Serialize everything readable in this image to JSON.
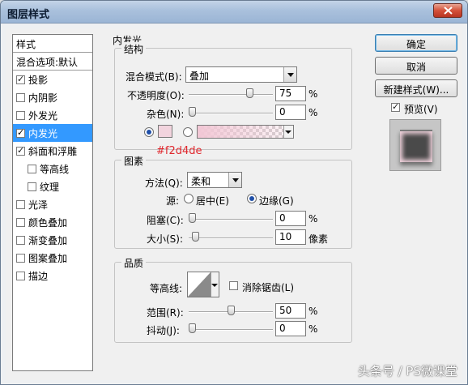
{
  "window": {
    "title": "图层样式"
  },
  "styles_list": {
    "header": "样式",
    "blend_options": "混合选项:默认",
    "items": [
      {
        "label": "投影",
        "checked": true,
        "indent": false,
        "selected": false
      },
      {
        "label": "内阴影",
        "checked": false,
        "indent": false,
        "selected": false
      },
      {
        "label": "外发光",
        "checked": false,
        "indent": false,
        "selected": false
      },
      {
        "label": "内发光",
        "checked": true,
        "indent": false,
        "selected": true
      },
      {
        "label": "斜面和浮雕",
        "checked": true,
        "indent": false,
        "selected": false
      },
      {
        "label": "等高线",
        "checked": false,
        "indent": true,
        "selected": false
      },
      {
        "label": "纹理",
        "checked": false,
        "indent": true,
        "selected": false
      },
      {
        "label": "光泽",
        "checked": false,
        "indent": false,
        "selected": false
      },
      {
        "label": "颜色叠加",
        "checked": false,
        "indent": false,
        "selected": false
      },
      {
        "label": "渐变叠加",
        "checked": false,
        "indent": false,
        "selected": false
      },
      {
        "label": "图案叠加",
        "checked": false,
        "indent": false,
        "selected": false
      },
      {
        "label": "描边",
        "checked": false,
        "indent": false,
        "selected": false
      }
    ]
  },
  "panel": {
    "title": "内发光",
    "structure": {
      "legend": "结构",
      "blend_mode_label": "混合模式(B):",
      "blend_mode_value": "叠加",
      "opacity_label": "不透明度(O):",
      "opacity_value": "75",
      "opacity_percent": 0.75,
      "noise_label": "杂色(N):",
      "noise_value": "0",
      "noise_percent": 0,
      "percent_unit": "%",
      "color_swatch": "#f2d4de",
      "color_hex_note": "#f2d4de",
      "color_mode": "solid"
    },
    "elements": {
      "legend": "图素",
      "method_label": "方法(Q):",
      "method_value": "柔和",
      "source_label": "源:",
      "source_center": "居中(E)",
      "source_edge": "边缘(G)",
      "source_selected": "edge",
      "choke_label": "阻塞(C):",
      "choke_value": "0",
      "choke_percent": 0,
      "size_label": "大小(S):",
      "size_value": "10",
      "size_unit": "像素",
      "size_fraction": 0.04
    },
    "quality": {
      "legend": "品质",
      "contour_label": "等高线:",
      "antialias_label": "消除锯齿(L)",
      "antialias_checked": false,
      "range_label": "范围(R):",
      "range_value": "50",
      "range_percent": 0.5,
      "jitter_label": "抖动(J):",
      "jitter_value": "0",
      "jitter_percent": 0
    }
  },
  "buttons": {
    "ok": "确定",
    "cancel": "取消",
    "new_style": "新建样式(W)...",
    "preview_label": "预览(V)",
    "preview_checked": true
  },
  "watermark": "头条号 / PS微课堂",
  "colors": {
    "selection": "#3399ff",
    "glow": "#f2d4de",
    "note_red": "#e0282e"
  }
}
